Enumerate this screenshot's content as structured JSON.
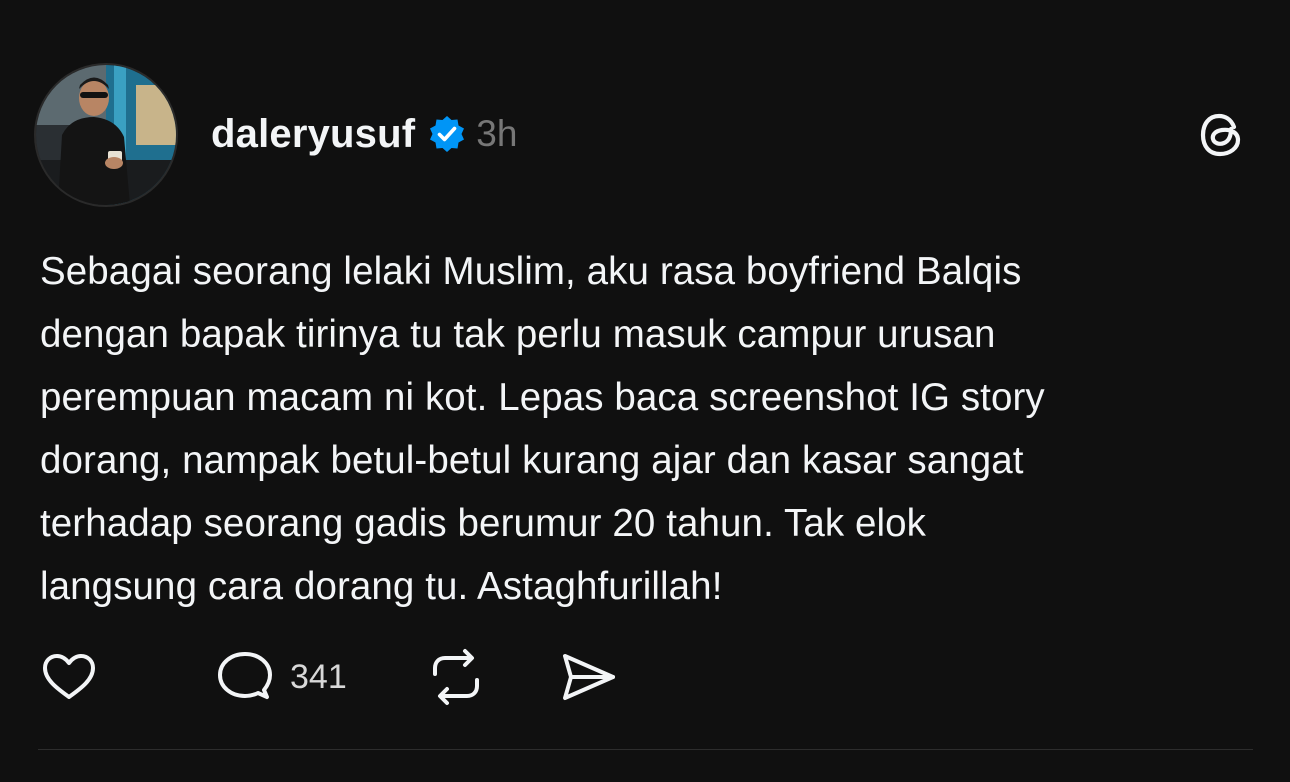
{
  "post": {
    "author": {
      "username": "daleryusuf",
      "verified": true
    },
    "timestamp": "3h",
    "text": "Sebagai seorang lelaki Muslim, aku rasa boyfriend Balqis\ndengan bapak tirinya tu tak perlu masuk campur urusan\nperempuan macam ni kot. Lepas baca screenshot IG story\ndorang, nampak betul-betul kurang ajar dan kasar sangat\nterhadap seorang gadis berumur 20 tahun. Tak elok\nlangsung cara dorang tu. Astaghfurillah!",
    "actions": {
      "reply_count": "341"
    }
  },
  "colors": {
    "background": "#101010",
    "text": "#f3f5f7",
    "muted": "#777777",
    "verified_badge": "#0095f6"
  },
  "icons": {
    "like": "heart-outline-icon",
    "reply": "speech-bubble-icon",
    "repost": "repost-arrows-icon",
    "share": "paper-plane-icon",
    "brand": "threads-logo-icon",
    "verified": "verified-badge-icon"
  }
}
